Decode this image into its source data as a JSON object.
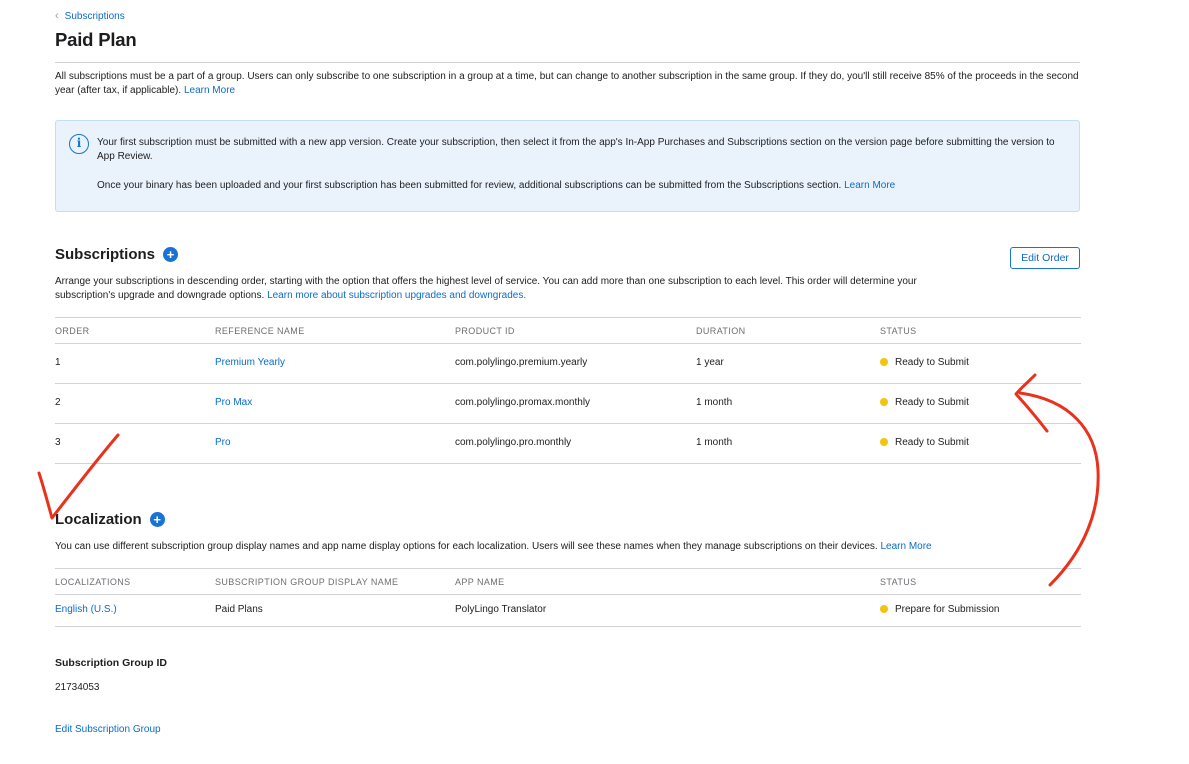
{
  "breadcrumb": {
    "label": "Subscriptions"
  },
  "page": {
    "title": "Paid Plan"
  },
  "intro": {
    "text": "All subscriptions must be a part of a group. Users can only subscribe to one subscription in a group at a time, but can change to another subscription in the same group. If they do, you'll still receive 85% of the proceeds in the second year (after tax, if applicable). ",
    "link": "Learn More"
  },
  "info": {
    "p1": "Your first subscription must be submitted with a new app version. Create your subscription, then select it from the app's In-App Purchases and Subscriptions section on the version page before submitting the version to App Review.",
    "p2": "Once your binary has been uploaded and your first subscription has been submitted for review, additional subscriptions can be submitted from the Subscriptions section. ",
    "p2_link": "Learn More"
  },
  "subscriptions": {
    "title": "Subscriptions",
    "edit_order": "Edit Order",
    "desc": "Arrange your subscriptions in descending order, starting with the option that offers the highest level of service. You can add more than one subscription to each level. This order will determine your subscription's upgrade and downgrade options. ",
    "desc_link": "Learn more about subscription upgrades and downgrades.",
    "columns": [
      "ORDER",
      "REFERENCE NAME",
      "PRODUCT ID",
      "DURATION",
      "STATUS"
    ],
    "rows": [
      {
        "order": "1",
        "name": "Premium Yearly",
        "product_id": "com.polylingo.premium.yearly",
        "duration": "1 year",
        "status": "Ready to Submit"
      },
      {
        "order": "2",
        "name": "Pro Max",
        "product_id": "com.polylingo.promax.monthly",
        "duration": "1 month",
        "status": "Ready to Submit"
      },
      {
        "order": "3",
        "name": "Pro",
        "product_id": "com.polylingo.pro.monthly",
        "duration": "1 month",
        "status": "Ready to Submit"
      }
    ]
  },
  "localization": {
    "title": "Localization",
    "desc": "You can use different subscription group display names and app name display options for each localization. Users will see these names when they manage subscriptions on their devices. ",
    "desc_link": "Learn More",
    "columns": [
      "LOCALIZATIONS",
      "SUBSCRIPTION GROUP DISPLAY NAME",
      "APP NAME",
      "STATUS"
    ],
    "rows": [
      {
        "locale": "English (U.S.)",
        "display_name": "Paid Plans",
        "app_name": "PolyLingo Translator",
        "status": "Prepare for Submission"
      }
    ]
  },
  "group": {
    "id_label": "Subscription Group ID",
    "id_value": "21734053",
    "edit_link": "Edit Subscription Group"
  },
  "colors": {
    "link": "#0a6cc9",
    "accent": "#1a73d3",
    "status_dot": "#f2c40f",
    "annotation": "#e8321c",
    "info_bg": "#eaf3fc"
  },
  "icons": {
    "breadcrumb": "chevron-left-icon",
    "info": "info-circle-icon",
    "add": "plus-circle-icon",
    "status": "status-dot-icon"
  }
}
